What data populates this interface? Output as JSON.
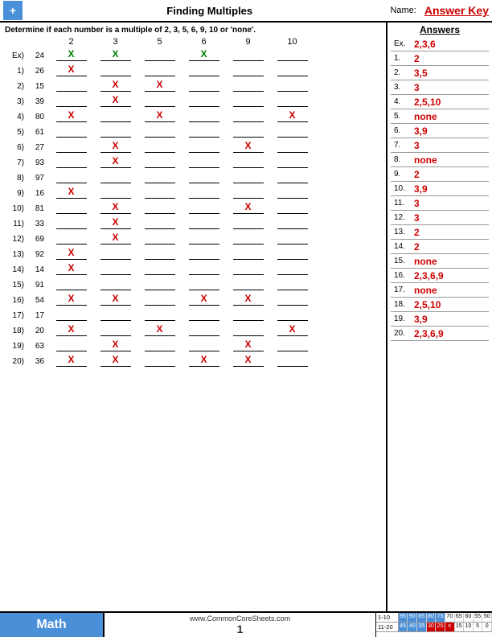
{
  "header": {
    "title": "Finding Multiples",
    "name_label": "Name:",
    "answer_key": "Answer Key",
    "logo": "+"
  },
  "instructions": "Determine if each number is a multiple of 2, 3, 5, 6, 9, 10 or 'none'.",
  "columns": [
    "2",
    "3",
    "5",
    "6",
    "9",
    "10"
  ],
  "example": {
    "label": "Ex)",
    "number": "24",
    "marks": [
      "green",
      "green",
      "",
      "green",
      "",
      ""
    ],
    "answer": "2,3,6"
  },
  "problems": [
    {
      "label": "1)",
      "number": "26",
      "marks": [
        "red",
        "",
        "",
        "",
        "",
        ""
      ],
      "answer": "2"
    },
    {
      "label": "2)",
      "number": "15",
      "marks": [
        "",
        "red",
        "red",
        "",
        "",
        ""
      ],
      "answer": "3,5"
    },
    {
      "label": "3)",
      "number": "39",
      "marks": [
        "",
        "red",
        "",
        "",
        "",
        ""
      ],
      "answer": "3"
    },
    {
      "label": "4)",
      "number": "80",
      "marks": [
        "red",
        "",
        "red",
        "",
        "",
        "red"
      ],
      "answer": "2,5,10"
    },
    {
      "label": "5)",
      "number": "61",
      "marks": [
        "",
        "",
        "",
        "",
        "",
        ""
      ],
      "answer": "none"
    },
    {
      "label": "6)",
      "number": "27",
      "marks": [
        "",
        "red",
        "",
        "",
        "red",
        ""
      ],
      "answer": "3,9"
    },
    {
      "label": "7)",
      "number": "93",
      "marks": [
        "",
        "red",
        "",
        "",
        "",
        ""
      ],
      "answer": "3"
    },
    {
      "label": "8)",
      "number": "97",
      "marks": [
        "",
        "",
        "",
        "",
        "",
        ""
      ],
      "answer": "none"
    },
    {
      "label": "9)",
      "number": "16",
      "marks": [
        "red",
        "",
        "",
        "",
        "",
        ""
      ],
      "answer": "2"
    },
    {
      "label": "10)",
      "number": "81",
      "marks": [
        "",
        "red",
        "",
        "",
        "red",
        ""
      ],
      "answer": "3,9"
    },
    {
      "label": "11)",
      "number": "33",
      "marks": [
        "",
        "red",
        "",
        "",
        "",
        ""
      ],
      "answer": "3"
    },
    {
      "label": "12)",
      "number": "69",
      "marks": [
        "",
        "red",
        "",
        "",
        "",
        ""
      ],
      "answer": "3"
    },
    {
      "label": "13)",
      "number": "92",
      "marks": [
        "red",
        "",
        "",
        "",
        "",
        ""
      ],
      "answer": "2"
    },
    {
      "label": "14)",
      "number": "14",
      "marks": [
        "red",
        "",
        "",
        "",
        "",
        ""
      ],
      "answer": "2"
    },
    {
      "label": "15)",
      "number": "91",
      "marks": [
        "",
        "",
        "",
        "",
        "",
        ""
      ],
      "answer": "none"
    },
    {
      "label": "16)",
      "number": "54",
      "marks": [
        "red",
        "red",
        "",
        "red",
        "red",
        ""
      ],
      "answer": "2,3,6,9"
    },
    {
      "label": "17)",
      "number": "17",
      "marks": [
        "",
        "",
        "",
        "",
        "",
        ""
      ],
      "answer": "none"
    },
    {
      "label": "18)",
      "number": "20",
      "marks": [
        "red",
        "",
        "red",
        "",
        "",
        "red"
      ],
      "answer": "2,5,10"
    },
    {
      "label": "19)",
      "number": "63",
      "marks": [
        "",
        "red",
        "",
        "",
        "red",
        ""
      ],
      "answer": "3,9"
    },
    {
      "label": "20)",
      "number": "36",
      "marks": [
        "red",
        "red",
        "",
        "red",
        "red",
        ""
      ],
      "answer": "2,3,6,9"
    }
  ],
  "answer_key_example": {
    "label": "Ex.",
    "answer": "2,3,6"
  },
  "footer": {
    "math_label": "Math",
    "website": "www.CommonCoreSheets.com",
    "page": "1",
    "score_rows": [
      {
        "label": "1-10",
        "scores": [
          "95",
          "90",
          "85",
          "80",
          "75",
          "70",
          "65",
          "60",
          "55",
          "50"
        ]
      },
      {
        "label": "11-20",
        "scores": [
          "45",
          "40",
          "35",
          "30",
          "25",
          "x",
          "15",
          "10",
          "5",
          "0"
        ]
      }
    ]
  }
}
